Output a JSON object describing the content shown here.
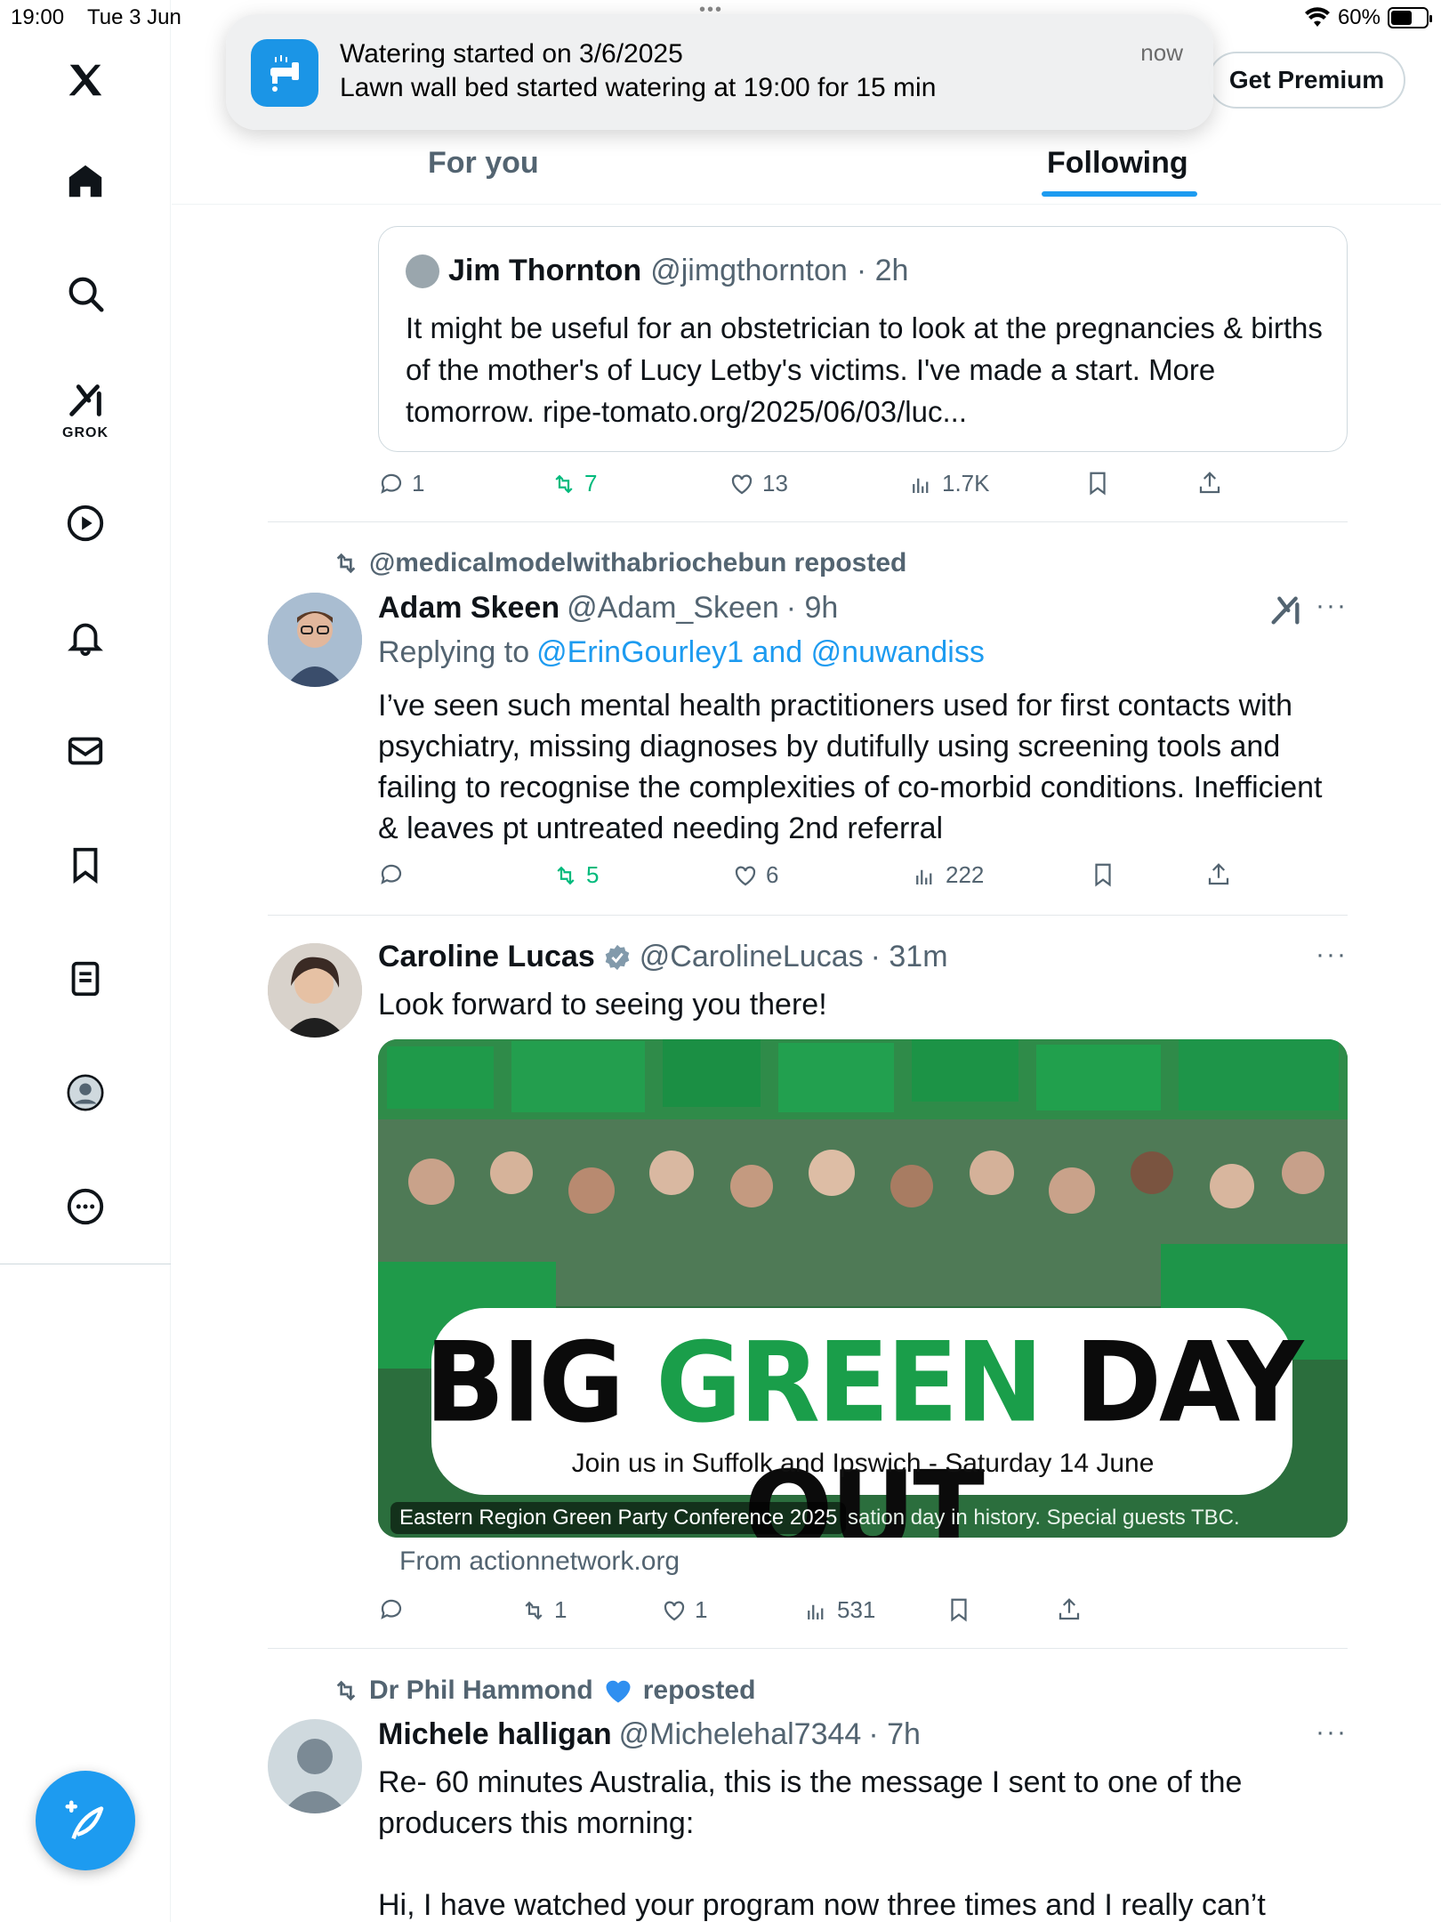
{
  "status_bar": {
    "time": "19:00",
    "date": "Tue 3 Jun",
    "battery": "60%",
    "battery_level": 0.6
  },
  "notification": {
    "title": "Watering started on 3/6/2025",
    "body": "Lawn wall bed started watering at 19:00 for 15 min",
    "time": "now"
  },
  "header": {
    "premium_label": "Get Premium",
    "tabs": [
      {
        "label": "For you"
      },
      {
        "label": "Following"
      }
    ]
  },
  "sidebar": {
    "grok_label": "GROK"
  },
  "posts": [
    {
      "quote": {
        "name": "Jim Thornton",
        "handle": "@jimgthornton",
        "time": "· 2h",
        "text": "It might be useful for an obstetrician to look at the pregnancies & births of the mother's of Lucy Letby's victims. I've made a start. More tomorrow.  ripe-tomato.org/2025/06/03/luc..."
      },
      "stats": {
        "replies": "1",
        "reposts": "7",
        "likes": "13",
        "views": "1.7K"
      }
    },
    {
      "repost_by": "@medicalmodelwithabriochebun reposted",
      "name": "Adam Skeen",
      "handle": "@Adam_Skeen",
      "time": "· 9h",
      "replying_prefix": "Replying to",
      "replying_to": "@ErinGourley1 and @nuwandiss",
      "text": "I’ve seen such mental health practitioners used for first contacts with psychiatry, missing diagnoses by dutifully using screening tools and failing to recognise the complexities of co-morbid conditions. Inefficient & leaves pt untreated needing 2nd referral",
      "stats": {
        "replies": "",
        "reposts": "5",
        "likes": "6",
        "views": "222"
      }
    },
    {
      "name": "Caroline Lucas",
      "handle": "@CarolineLucas",
      "time": "· 31m",
      "text": "Look forward to seeing you there!",
      "media": {
        "headline_part1": "BIG",
        "headline_part2": "GREEN",
        "headline_part3": "DAY OUT",
        "subline": "Join us in Suffolk and Ipswich - Saturday 14 June",
        "caption": "Eastern Region Green Party Conference 2025",
        "caption_tail": "sation day in history. Special guests TBC.",
        "source": "From actionnetwork.org"
      },
      "stats": {
        "replies": "",
        "reposts": "1",
        "likes": "1",
        "views": "531"
      }
    },
    {
      "repost_by_name": "Dr Phil Hammond",
      "repost_suffix": "reposted",
      "name": "Michele halligan",
      "handle": "@Michelehal7344",
      "time": "· 7h",
      "text": "Re- 60 minutes Australia, this is the message I sent to one of the producers this morning:",
      "text2": "Hi, I have watched your program now three times and I really can’t"
    }
  ],
  "colors": {
    "accent": "#1d9bf0",
    "repost_green": "#00ba7c",
    "muted": "#536471",
    "green_party": "#1a9e4a"
  }
}
